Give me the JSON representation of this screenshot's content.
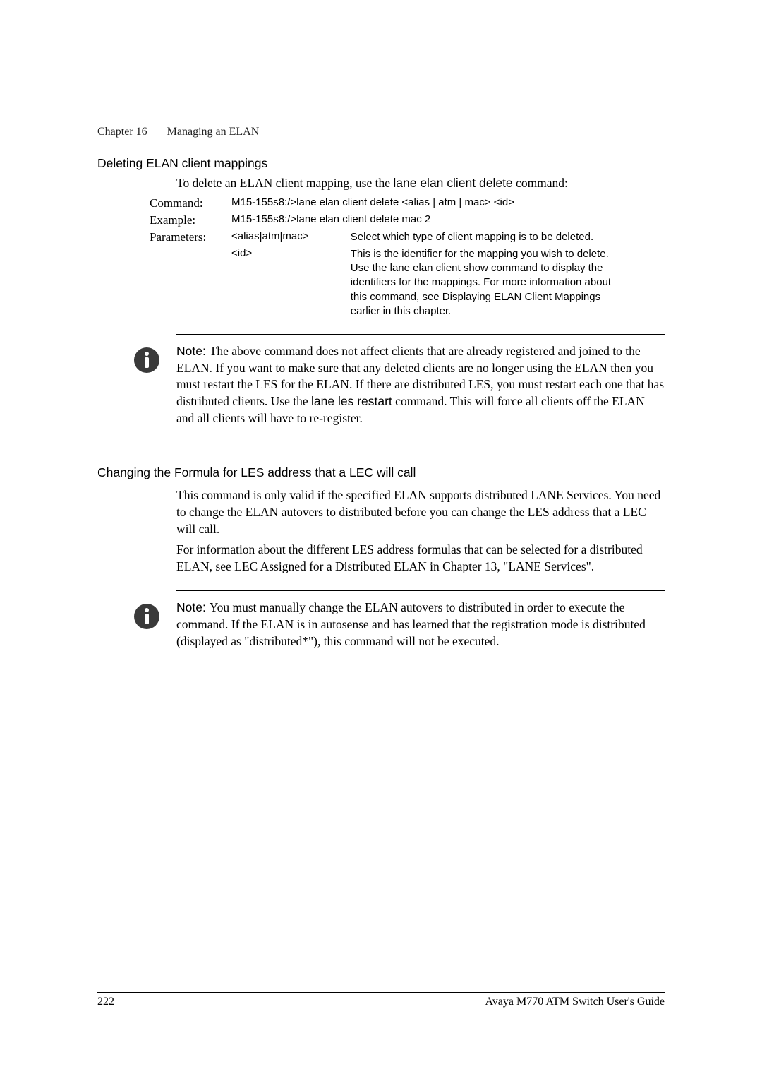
{
  "header": {
    "chapter": "Chapter 16",
    "title": "Managing an ELAN"
  },
  "section_a": {
    "heading": "Deleting ELAN client mappings",
    "intro_1": "To delete an ELAN client mapping, use the ",
    "intro_cmd": "lane elan client delete",
    "intro_2": " command:",
    "labels": {
      "command": "Command:",
      "example": "Example:",
      "parameters": "Parameters:"
    },
    "command_line": "M15-155s8:/>lane elan client delete <alias | atm | mac> <id>",
    "example_line": "M15-155s8:/>lane elan client delete mac 2",
    "params": {
      "p1_left": "<alias|atm|mac>",
      "p1_right": "Select which type of client  mapping is to be deleted.",
      "p2_left": "<id>",
      "p2_r1": "This is the identifier for the mapping you wish to delete.",
      "p2_r2a": "Use the ",
      "p2_r2_cmd": "lane elan client show",
      "p2_r2b": " command to display the identifiers for the mappings. For more information about this command, see  Displaying ELAN Client Mappings  earlier in this chapter."
    }
  },
  "note1": {
    "label": "Note: ",
    "body_1": "The above command does not affect clients that are already registered and joined to the ELAN. If you want to make sure that any deleted clients are no longer using the ELAN then you must restart the LES for the ELAN. If there are distributed LES, you must restart each one that has distributed clients. Use the ",
    "cmd": "lane les restart",
    "body_2": " command. This will force all clients off the ELAN and all clients will have to re-register."
  },
  "section_b": {
    "heading": "Changing the Formula for LES address that a LEC will call",
    "p1": "This command is only valid if the specified ELAN supports distributed LANE Services. You need to change the ELAN autovers to distributed before you can change the LES address that a LEC will call.",
    "p2": "For information about the different LES address formulas that can be selected for a distributed ELAN, see LEC Assigned for a Distributed ELAN in Chapter 13, \"LANE Services\"."
  },
  "note2": {
    "label": "Note: ",
    "body": "You must manually change the ELAN autovers to distributed in order to execute the command. If the ELAN is in autosense and has learned that the registration mode is distributed (displayed as \"distributed*\"), this command will not be executed."
  },
  "footer": {
    "page": "222",
    "doc": "Avaya M770 ATM Switch User's Guide"
  }
}
